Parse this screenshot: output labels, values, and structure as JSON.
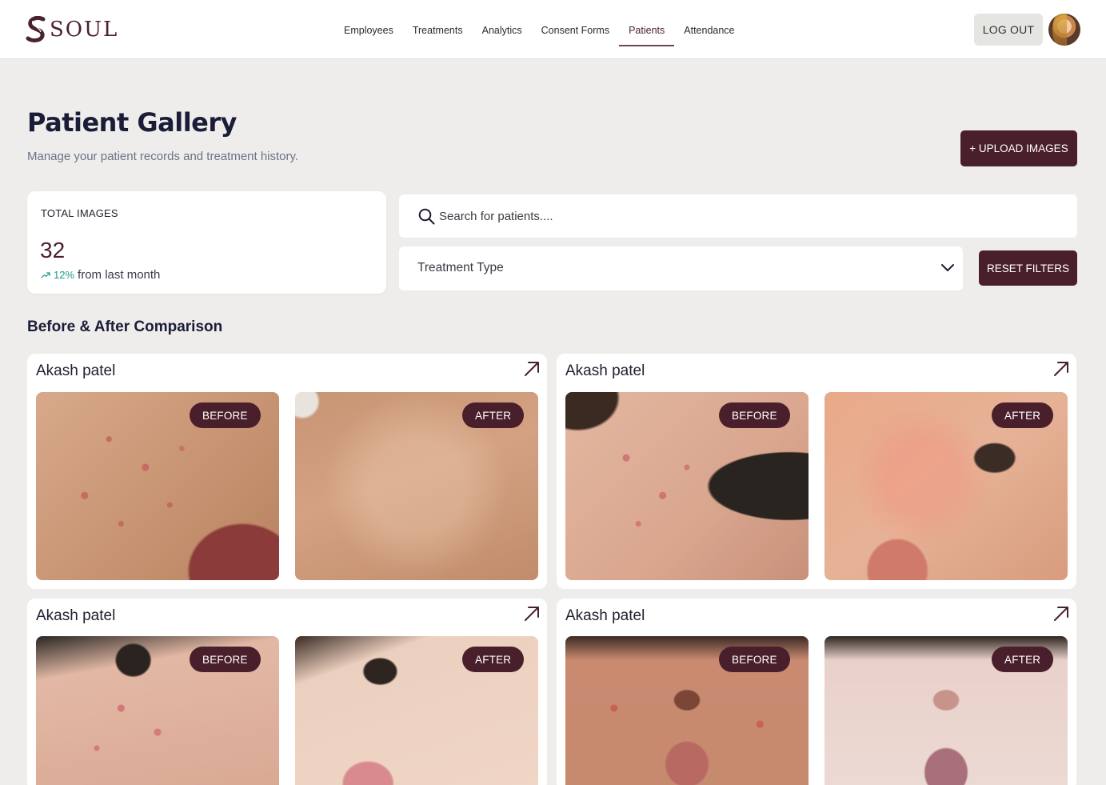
{
  "brand": {
    "name": "SOUL"
  },
  "nav": {
    "items": [
      {
        "label": "Employees",
        "active": false
      },
      {
        "label": "Treatments",
        "active": false
      },
      {
        "label": "Analytics",
        "active": false
      },
      {
        "label": "Consent Forms",
        "active": false
      },
      {
        "label": "Patients",
        "active": true
      },
      {
        "label": "Attendance",
        "active": false
      }
    ],
    "logout_label": "LOG OUT"
  },
  "page": {
    "title": "Patient Gallery",
    "subtitle": "Manage your patient records and treatment history.",
    "upload_label": "+ UPLOAD IMAGES"
  },
  "stats": {
    "label": "TOTAL IMAGES",
    "value": "32",
    "trend_pct": "12%",
    "trend_text": "from last month"
  },
  "search": {
    "placeholder": "Search for patients...."
  },
  "filters": {
    "treatment_type": "Treatment Type",
    "reset_label": "RESET FILTERS"
  },
  "section": {
    "title": "Before & After Comparison"
  },
  "gallery": [
    {
      "name": "Akash patel",
      "before_label": "BEFORE",
      "after_label": "AFTER"
    },
    {
      "name": "Akash patel",
      "before_label": "BEFORE",
      "after_label": "AFTER"
    },
    {
      "name": "Akash patel",
      "before_label": "BEFORE",
      "after_label": "AFTER"
    },
    {
      "name": "Akash patel",
      "before_label": "BEFORE",
      "after_label": "AFTER"
    }
  ],
  "colors": {
    "brand": "#4a1f2c",
    "accent_trend": "#1a9c8e",
    "background": "#eeedeb"
  },
  "icons": {
    "search": "search-icon",
    "chevron": "chevron-down-icon",
    "expand": "arrow-up-right-icon",
    "trend": "trending-up-icon"
  }
}
